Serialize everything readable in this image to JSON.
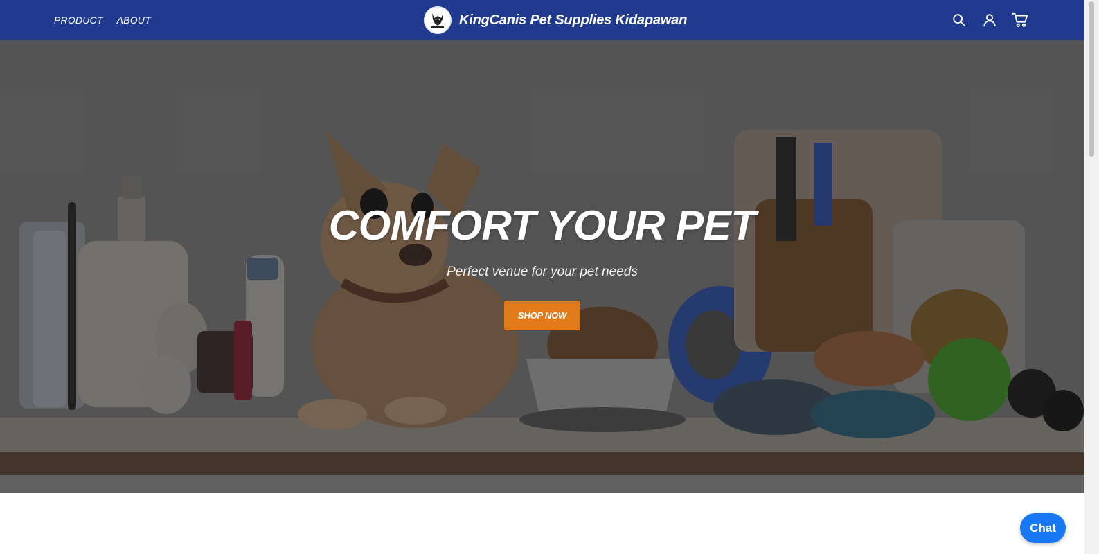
{
  "header": {
    "nav": [
      {
        "label": "PRODUCT"
      },
      {
        "label": "ABOUT"
      }
    ],
    "brand_name": "KingCanis Pet Supplies Kidapawan",
    "icons": [
      "search-icon",
      "user-icon",
      "cart-icon"
    ],
    "background": "#1f3a8f"
  },
  "hero": {
    "title": "COMFORT YOUR PET",
    "subtitle": "Perfect venue for your pet needs",
    "cta_label": "SHOP NOW",
    "cta_color": "#e07a1a"
  },
  "chat": {
    "label": "Chat",
    "color": "#1877f2"
  }
}
